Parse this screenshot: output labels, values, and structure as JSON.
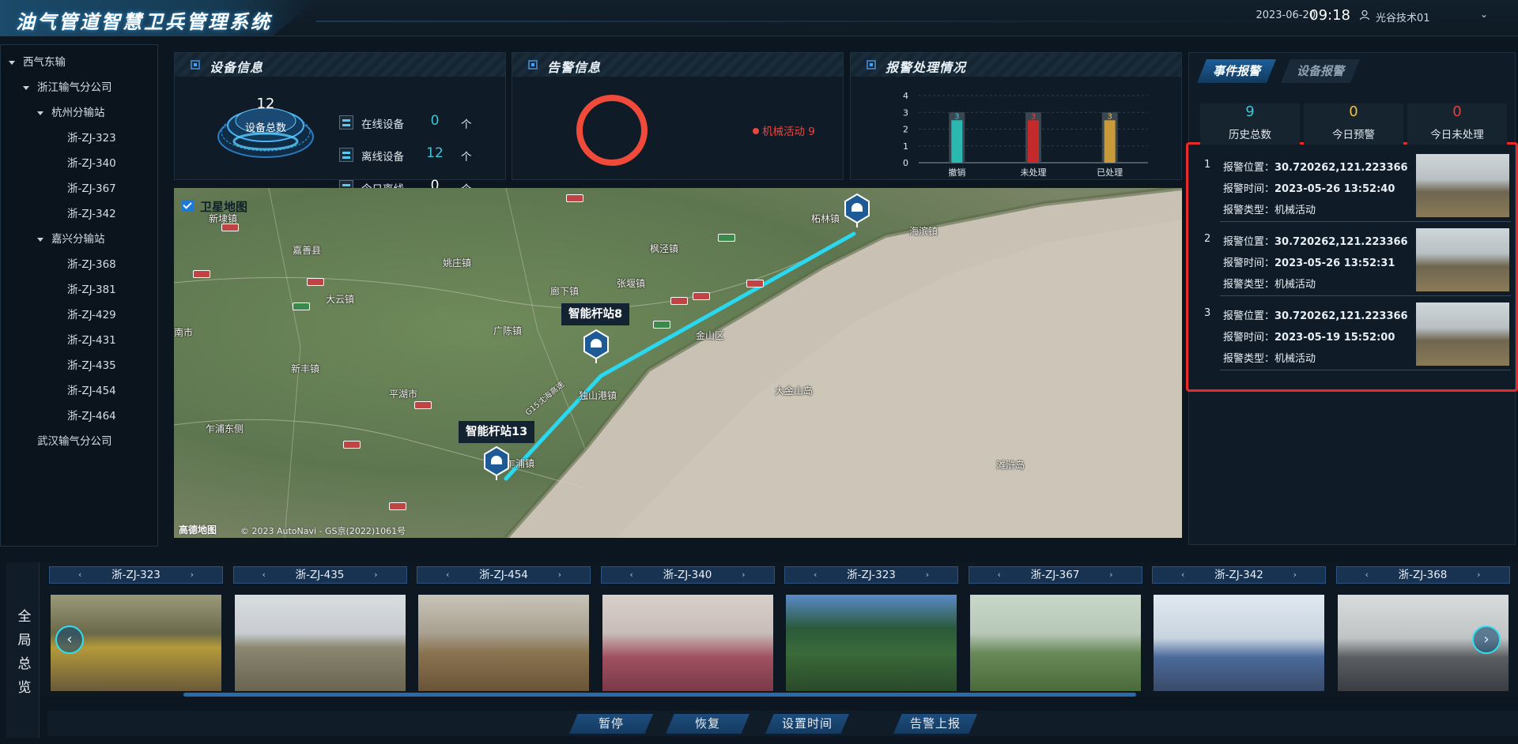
{
  "header": {
    "title": "油气管道智慧卫兵管理系统",
    "date": "2023-06-20",
    "time": "09:18",
    "user": "光谷技术01",
    "user_icon": "user-icon",
    "menu_icon": "chevron-down-icon"
  },
  "tree": {
    "items": [
      {
        "label": "西气东输",
        "level": 0,
        "expanded": true
      },
      {
        "label": "浙江输气分公司",
        "level": 1,
        "expanded": true
      },
      {
        "label": "杭州分输站",
        "level": 2,
        "expanded": true
      },
      {
        "label": "浙-ZJ-323",
        "level": 3
      },
      {
        "label": "浙-ZJ-340",
        "level": 3
      },
      {
        "label": "浙-ZJ-367",
        "level": 3
      },
      {
        "label": "浙-ZJ-342",
        "level": 3
      },
      {
        "label": "嘉兴分输站",
        "level": 2,
        "expanded": true
      },
      {
        "label": "浙-ZJ-368",
        "level": 3
      },
      {
        "label": "浙-ZJ-381",
        "level": 3
      },
      {
        "label": "浙-ZJ-429",
        "level": 3
      },
      {
        "label": "浙-ZJ-431",
        "level": 3
      },
      {
        "label": "浙-ZJ-435",
        "level": 3
      },
      {
        "label": "浙-ZJ-454",
        "level": 3
      },
      {
        "label": "浙-ZJ-464",
        "level": 3
      },
      {
        "label": "武汉输气分公司",
        "level": 1
      }
    ]
  },
  "device_info": {
    "title": "设备信息",
    "total": "12",
    "total_label": "设备总数",
    "rows": [
      {
        "label": "在线设备",
        "value": "0",
        "unit": "个",
        "color": "#3ec6d8"
      },
      {
        "label": "离线设备",
        "value": "12",
        "unit": "个",
        "color": "#3ec6d8"
      },
      {
        "label": "今日离线",
        "value": "0",
        "unit": "个",
        "color": "#ffffff"
      }
    ]
  },
  "alarm_info": {
    "title": "告警信息",
    "legend": "机械活动 9",
    "color": "#e8473f"
  },
  "handling": {
    "title": "报警处理情况"
  },
  "chart_data": {
    "type": "bar",
    "categories": [
      "撤销",
      "未处理",
      "已处理"
    ],
    "values": [
      3,
      3,
      3
    ],
    "colors": [
      "#2ab8b0",
      "#c42a2a",
      "#c89a3a"
    ],
    "data_labels": [
      "3",
      "3",
      "3"
    ],
    "label_colors": [
      "#3ec6d8",
      "#e84040",
      "#f0c040"
    ],
    "yticks": [
      "0",
      "1",
      "2",
      "3",
      "4"
    ],
    "ylim": [
      0,
      4
    ],
    "grid": true
  },
  "map": {
    "layer_label": "卫星地图",
    "logo": "高德地图",
    "copyright": "© 2023 AutoNavi - GS京(2022)1061号",
    "places": [
      "嘉善县",
      "姚庄镇",
      "大云镇",
      "枫泾镇",
      "廊下镇",
      "张堰镇",
      "金山区",
      "广陈镇",
      "新丰镇",
      "平湖市",
      "独山港镇",
      "乍浦镇",
      "大金山岛",
      "滩浒岛",
      "海滨镇",
      "柘林镇",
      "新埭镇",
      "南市",
      "乍浦东侧"
    ],
    "stations": [
      "智能杆站8",
      "智能杆站13"
    ],
    "highway_label": "G15沈海高速"
  },
  "event": {
    "tabs": [
      "事件报警",
      "设备报警"
    ],
    "stats": [
      {
        "value": "9",
        "label": "历史总数",
        "color": "#3ec6d8"
      },
      {
        "value": "0",
        "label": "今日预警",
        "color": "#f0c040"
      },
      {
        "value": "0",
        "label": "今日未处理",
        "color": "#e84040"
      }
    ],
    "items": [
      {
        "idx": "1",
        "pos_label": "报警位置：",
        "pos": "30.720262,121.223366",
        "time_label": "报警时间：",
        "time": "2023-05-26 13:52:40",
        "type_label": "报警类型：",
        "type": "机械活动"
      },
      {
        "idx": "2",
        "pos_label": "报警位置：",
        "pos": "30.720262,121.223366",
        "time_label": "报警时间：",
        "time": "2023-05-26 13:52:31",
        "type_label": "报警类型：",
        "type": "机械活动"
      },
      {
        "idx": "3",
        "pos_label": "报警位置：",
        "pos": "30.720262,121.223366",
        "time_label": "报警时间：",
        "time": "2023-05-19 15:52:00",
        "type_label": "报警类型：",
        "type": "机械活动"
      }
    ]
  },
  "strip": {
    "label": "全局总览",
    "cameras": [
      "浙-ZJ-323",
      "浙-ZJ-435",
      "浙-ZJ-454",
      "浙-ZJ-340",
      "浙-ZJ-323",
      "浙-ZJ-367",
      "浙-ZJ-342",
      "浙-ZJ-368"
    ],
    "prev_icon": "chevron-left-icon",
    "next_icon": "chevron-right-icon",
    "arrow_left": "‹",
    "arrow_right": "›"
  },
  "actions": [
    "暂停",
    "恢复",
    "设置时间",
    "告警上报"
  ]
}
